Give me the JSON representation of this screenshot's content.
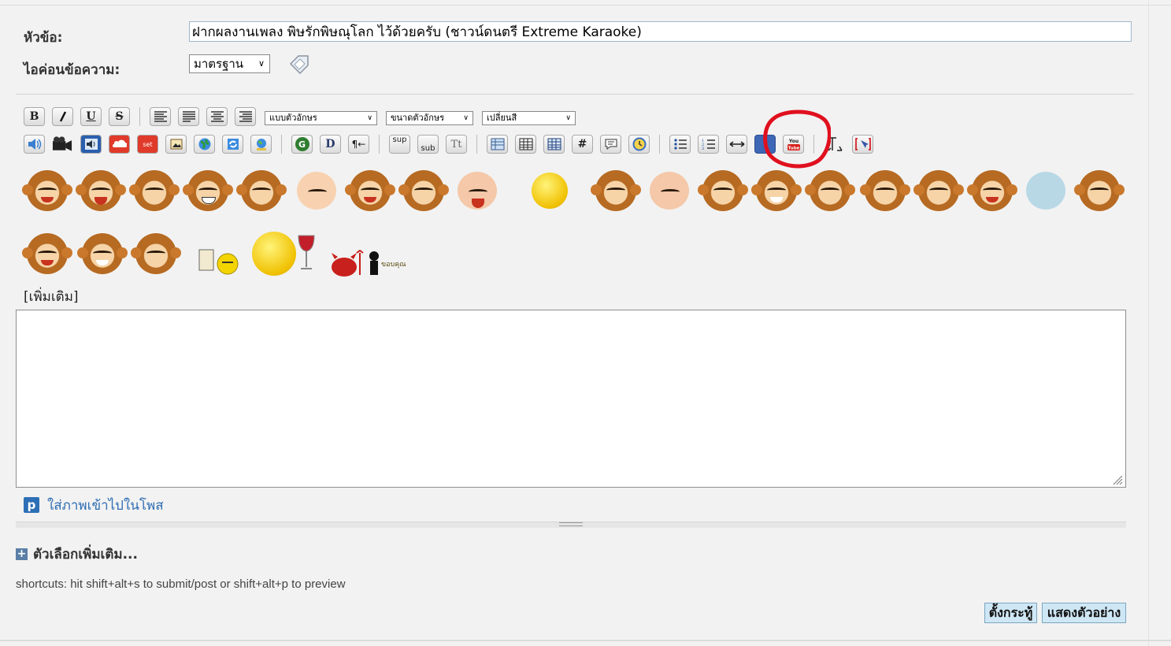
{
  "form": {
    "subject_label": "หัวข้อ:",
    "subject_value": "ฝากผลงานเพลง พิษรักพิษณุโลก ไว้ด้วยครับ (ชาวน์ดนตรี Extreme Karaoke)",
    "icon_label": "ไอค่อนข้อความ:",
    "icon_select_value": "มาตรฐาน"
  },
  "toolbar": {
    "bold": "B",
    "italic": "I",
    "underline": "U",
    "strike": "S",
    "font_select": "แบบตัวอักษร",
    "size_select": "ขนาดตัวอักษร",
    "color_select": "เปลี่ยนสี",
    "google_label": "G",
    "d_label": "D",
    "sup_label": "sup",
    "sub_label": "sub",
    "tt_label": "Tt",
    "hash_label": "#",
    "youtube_label": "You Tube",
    "thanks_label": "ขอบคุณ"
  },
  "smilies": {
    "more_link": "[เพิ่มเติม]"
  },
  "message": {
    "value": ""
  },
  "photo": {
    "icon_letter": "p",
    "link_text": "ใส่ภาพเข้าไปในโพส"
  },
  "options": {
    "plus": "+",
    "more_options": "ตัวเลือกเพิ่มเติม..."
  },
  "shortcuts_text": "shortcuts: hit shift+alt+s to submit/post or shift+alt+p to preview",
  "buttons": {
    "submit": "ตั้งกระทู้",
    "preview": "แสดงตัวอย่าง"
  },
  "colors": {
    "link_blue": "#2e6db4",
    "annotation_red": "#e0101e",
    "button_bg": "#cfe7f5"
  }
}
